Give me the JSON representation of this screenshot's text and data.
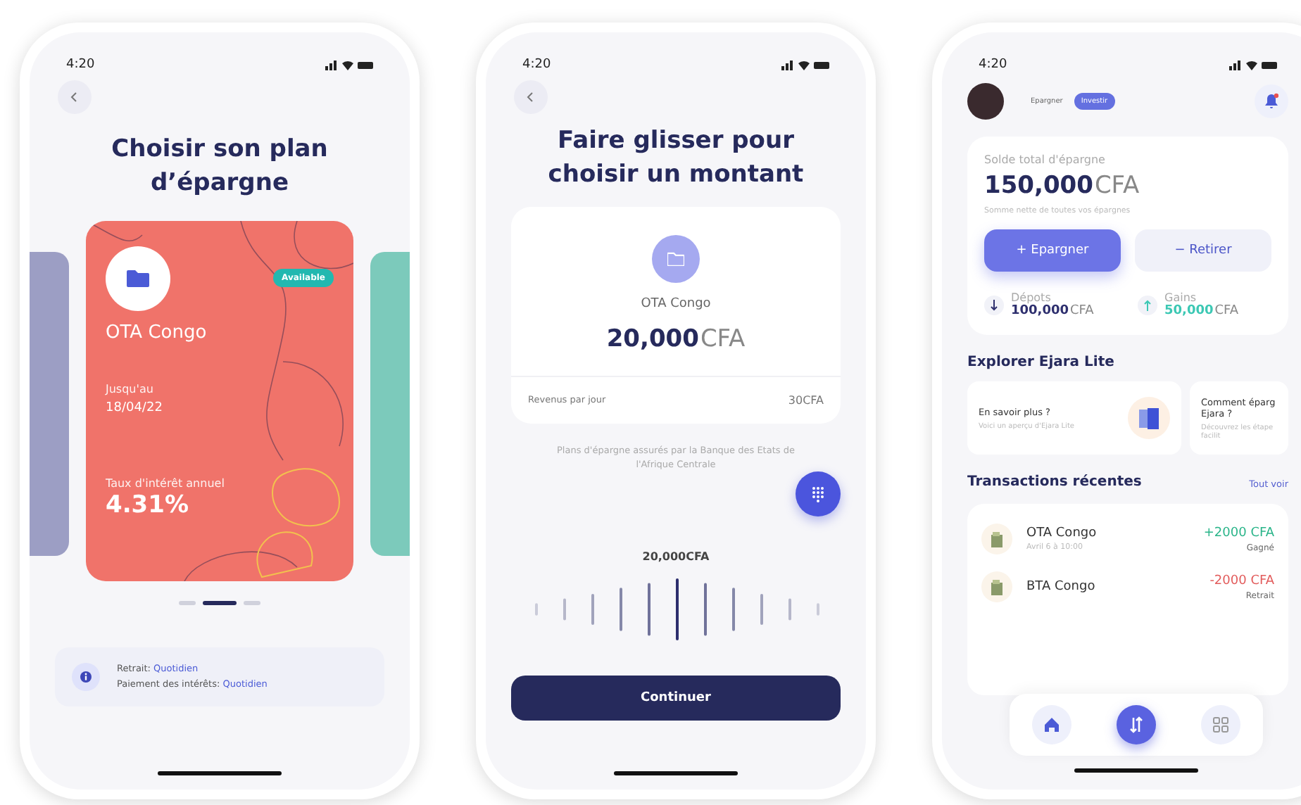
{
  "plan_screen": {
    "time": "4:20",
    "title": "Choisir son plan d’épargne",
    "card": {
      "name": "OTA Congo",
      "badge": "Available",
      "date_label": "Jusqu'au",
      "date": "18/04/22",
      "rate_label": "Taux d'intérêt annuel",
      "rate": "4.31%"
    },
    "pager": [
      {
        "selected": false
      },
      {
        "selected": true
      },
      {
        "selected": false
      }
    ],
    "info": [
      {
        "label": "Retrait:",
        "value": "Quotidien"
      },
      {
        "label": "Paiement des intérêts:",
        "value": "Quotidien"
      }
    ]
  },
  "amount_screen": {
    "time": "4:20",
    "title": "Faire glisser pour choisir un montant",
    "plan_name": "OTA Congo",
    "amount": "20,000",
    "currency": "CFA",
    "revenue_label": "Revenus par jour",
    "revenue": "30CFA",
    "note": "Plans d'épargne assurés par la Banque des Etats de l'Afrique Centrale",
    "slider_value": "20,000CFA",
    "button": "Continuer"
  },
  "home_screen": {
    "time": "4:20",
    "toggle": [
      {
        "label": "Epargner",
        "selected": false
      },
      {
        "label": "Investir",
        "selected": true
      }
    ],
    "balance_label": "Solde total d'épargne",
    "balance_amount": "150,000",
    "balance_currency": "CFA",
    "balance_note": "Somme nette de toutes vos épargnes",
    "buttons": [
      {
        "label": "+ Epargner",
        "kind": "primary"
      },
      {
        "label": "− Retirer",
        "kind": "secondary"
      }
    ],
    "stats": [
      {
        "label": "Dépots",
        "amount": "100,000",
        "currency": "CFA",
        "kind": "down",
        "color": "#2e2f6e"
      },
      {
        "label": "Gains",
        "amount": "50,000",
        "currency": "CFA",
        "kind": "up",
        "color": "#3cc8b4"
      }
    ],
    "explore_title": "Explorer Ejara Lite",
    "explore_cards": [
      {
        "title": "En savoir plus ?",
        "text": "Voici un aperçu d'Ejara Lite"
      },
      {
        "title": "Comment éparg Ejara ?",
        "text": "Découvrez les étape facilit"
      }
    ],
    "transactions_title": "Transactions récentes",
    "see_all": "Tout voir",
    "transactions": [
      {
        "name": "OTA Congo",
        "date": "Avril 6 à 10:00",
        "amount": "+2000 CFA",
        "status": "Gagné",
        "color": "#2bb58a"
      },
      {
        "name": "BTA Congo",
        "amount": "-2000 CFA",
        "status": "Retrait",
        "color": "#e25c5c"
      }
    ],
    "nav": [
      {
        "kind": "home",
        "selected": false
      },
      {
        "kind": "transfer",
        "selected": true
      },
      {
        "kind": "grid",
        "selected": false
      }
    ]
  }
}
